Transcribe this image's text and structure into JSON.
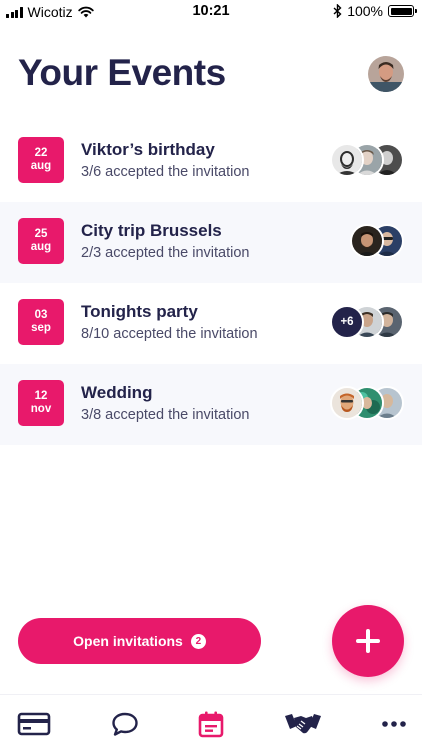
{
  "status_bar": {
    "carrier": "Wicotiz",
    "time": "10:21",
    "battery": "100%"
  },
  "header": {
    "title": "Your Events"
  },
  "events": [
    {
      "day": "22",
      "month": "aug",
      "title": "Viktor’s birthday",
      "subtitle": "3/6 accepted the invitation"
    },
    {
      "day": "25",
      "month": "aug",
      "title": "City trip Brussels",
      "subtitle": "2/3 accepted the invitation"
    },
    {
      "day": "03",
      "month": "sep",
      "title": "Tonights party",
      "subtitle": "8/10 accepted the invitation",
      "extra_count": "+6"
    },
    {
      "day": "12",
      "month": "nov",
      "title": "Wedding",
      "subtitle": "3/8 accepted the invitation"
    }
  ],
  "actions": {
    "open_invitations_label": "Open invitations",
    "open_invitations_count": "2",
    "add_icon": "plus-icon"
  },
  "tab_bar": {
    "items": [
      "card-icon",
      "chat-bubble-icon",
      "calendar-icon",
      "handshake-icon",
      "more-dots-icon"
    ],
    "active": "calendar-icon"
  },
  "colors": {
    "accent": "#e8196b",
    "text_dark": "#23234a",
    "row_alt": "#f7f8fc"
  }
}
